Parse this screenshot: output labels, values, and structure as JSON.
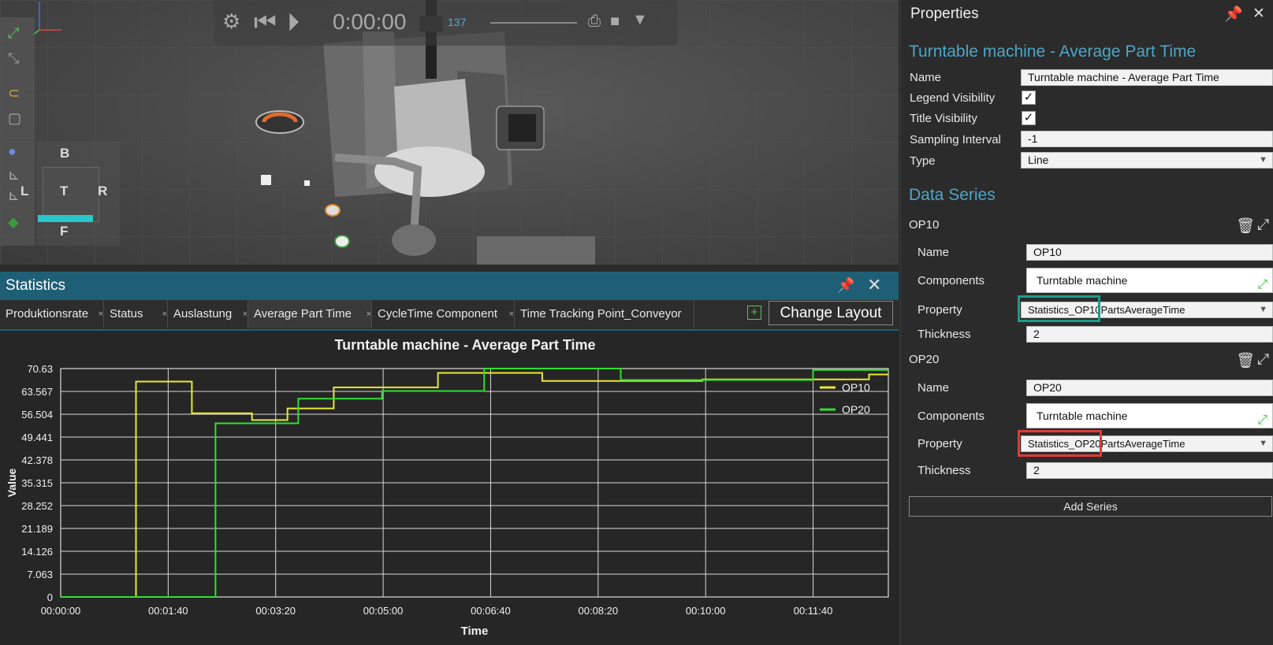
{
  "viewport": {
    "playback_time": "0:00:00",
    "coord_readout": "137",
    "viewcube": {
      "top": "B",
      "left": "L",
      "center": "T",
      "right": "R",
      "bottom": "F"
    }
  },
  "statistics": {
    "title": "Statistics",
    "tabs": [
      {
        "label": "Produktionsrate",
        "active": false
      },
      {
        "label": "Status",
        "active": false
      },
      {
        "label": "Auslastung",
        "active": false
      },
      {
        "label": "Average Part Time",
        "active": true
      },
      {
        "label": "CycleTime Component",
        "active": false
      },
      {
        "label": "Time Tracking Point_Conveyor",
        "active": false
      }
    ],
    "change_layout_label": "Change Layout"
  },
  "chart_data": {
    "type": "line",
    "title": "Turntable machine - Average Part Time",
    "xlabel": "Time",
    "ylabel": "Value",
    "ylim": [
      0,
      70.63
    ],
    "yticks": [
      "70.63",
      "63.567",
      "56.504",
      "49.441",
      "42.378",
      "35.315",
      "28.252",
      "21.189",
      "14.126",
      "7.063",
      "0"
    ],
    "xticks": [
      "00:00:00",
      "00:01:40",
      "00:03:20",
      "00:05:00",
      "00:06:40",
      "00:08:20",
      "00:10:00",
      "00:11:40"
    ],
    "xlim_seconds": [
      0,
      770
    ],
    "grid": true,
    "legend_position": "top-right",
    "series": [
      {
        "name": "OP10",
        "color": "#e8e832",
        "x": [
          0,
          70,
          70,
          122,
          122,
          178,
          178,
          211,
          211,
          254,
          254,
          351,
          351,
          448,
          448,
          597,
          597,
          752,
          752,
          770
        ],
        "y": [
          0,
          0,
          66.6,
          66.6,
          56.8,
          56.8,
          54.7,
          54.7,
          58.3,
          58.3,
          64.8,
          64.8,
          69.3,
          69.3,
          66.8,
          66.8,
          67.3,
          67.3,
          68.8,
          68.8
        ]
      },
      {
        "name": "OP20",
        "color": "#33dd33",
        "x": [
          0,
          144,
          144,
          221,
          221,
          299,
          299,
          394,
          394,
          521,
          521,
          700,
          700,
          770
        ],
        "y": [
          0,
          0,
          53.7,
          53.7,
          61.3,
          61.3,
          63.7,
          63.7,
          70.63,
          70.63,
          67.1,
          67.1,
          70.2,
          70.2
        ]
      }
    ]
  },
  "properties": {
    "title": "Properties",
    "chart_title": "Turntable machine - Average Part Time",
    "name_label": "Name",
    "name_value": "Turntable machine - Average Part Time",
    "legend_label": "Legend Visibility",
    "title_vis_label": "Title Visibility",
    "sampling_label": "Sampling Interval",
    "sampling_value": "-1",
    "type_label": "Type",
    "type_value": "Line",
    "data_series_title": "Data Series",
    "series": [
      {
        "header": "OP10",
        "name_label": "Name",
        "name": "OP10",
        "components_label": "Components",
        "components": "Turntable machine",
        "property_label": "Property",
        "property": "Statistics_OP10PartsAverageTime",
        "thickness_label": "Thickness",
        "thickness": "2"
      },
      {
        "header": "OP20",
        "name_label": "Name",
        "name": "OP20",
        "components_label": "Components",
        "components": "Turntable machine",
        "property_label": "Property",
        "property": "Statistics_OP20PartsAverageTime",
        "thickness_label": "Thickness",
        "thickness": "2"
      }
    ],
    "add_series_label": "Add Series",
    "highlight_colors": {
      "op10": "#1a9c8c",
      "op20": "#e03a3a"
    }
  }
}
